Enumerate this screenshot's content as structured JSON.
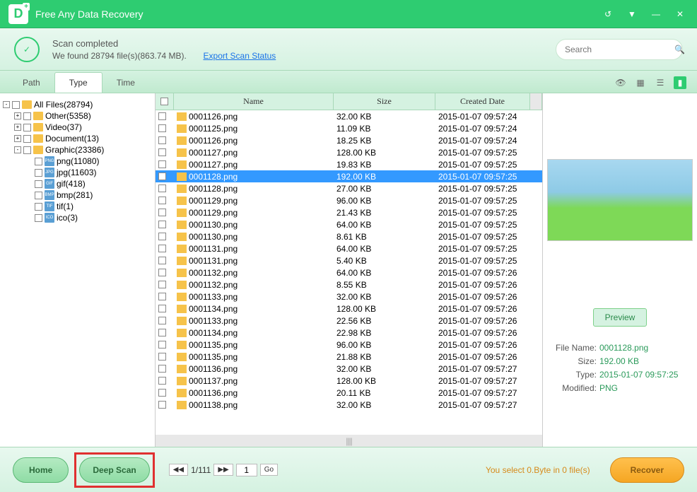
{
  "titlebar": {
    "app_name": "Free Any Data Recovery"
  },
  "status": {
    "title": "Scan completed",
    "detail": "We found 28794 file(s)(863.74 MB).",
    "export_link": "Export Scan Status"
  },
  "search": {
    "placeholder": "Search"
  },
  "tabs": {
    "path": "Path",
    "type": "Type",
    "time": "Time"
  },
  "tree": [
    {
      "level": 0,
      "toggle": "-",
      "label": "All Files(28794)",
      "icon": "folder"
    },
    {
      "level": 1,
      "toggle": "+",
      "label": "Other(5358)",
      "icon": "folder"
    },
    {
      "level": 1,
      "toggle": "+",
      "label": "Video(37)",
      "icon": "folder"
    },
    {
      "level": 1,
      "toggle": "+",
      "label": "Document(13)",
      "icon": "folder"
    },
    {
      "level": 1,
      "toggle": "-",
      "label": "Graphic(23386)",
      "icon": "folder"
    },
    {
      "level": 2,
      "toggle": "",
      "label": "png(11080)",
      "icon": "png"
    },
    {
      "level": 2,
      "toggle": "",
      "label": "jpg(11603)",
      "icon": "jpg"
    },
    {
      "level": 2,
      "toggle": "",
      "label": "gif(418)",
      "icon": "gif"
    },
    {
      "level": 2,
      "toggle": "",
      "label": "bmp(281)",
      "icon": "bmp"
    },
    {
      "level": 2,
      "toggle": "",
      "label": "tif(1)",
      "icon": "tif"
    },
    {
      "level": 2,
      "toggle": "",
      "label": "ico(3)",
      "icon": "ico"
    }
  ],
  "columns": {
    "name": "Name",
    "size": "Size",
    "date": "Created Date"
  },
  "files": [
    {
      "name": "0001126.png",
      "size": "32.00 KB",
      "date": "2015-01-07 09:57:24"
    },
    {
      "name": "0001125.png",
      "size": "11.09 KB",
      "date": "2015-01-07 09:57:24"
    },
    {
      "name": "0001126.png",
      "size": "18.25 KB",
      "date": "2015-01-07 09:57:24"
    },
    {
      "name": "0001127.png",
      "size": "128.00 KB",
      "date": "2015-01-07 09:57:25"
    },
    {
      "name": "0001127.png",
      "size": "19.83 KB",
      "date": "2015-01-07 09:57:25"
    },
    {
      "name": "0001128.png",
      "size": "192.00 KB",
      "date": "2015-01-07 09:57:25",
      "selected": true
    },
    {
      "name": "0001128.png",
      "size": "27.00 KB",
      "date": "2015-01-07 09:57:25"
    },
    {
      "name": "0001129.png",
      "size": "96.00 KB",
      "date": "2015-01-07 09:57:25"
    },
    {
      "name": "0001129.png",
      "size": "21.43 KB",
      "date": "2015-01-07 09:57:25"
    },
    {
      "name": "0001130.png",
      "size": "64.00 KB",
      "date": "2015-01-07 09:57:25"
    },
    {
      "name": "0001130.png",
      "size": "8.61 KB",
      "date": "2015-01-07 09:57:25"
    },
    {
      "name": "0001131.png",
      "size": "64.00 KB",
      "date": "2015-01-07 09:57:25"
    },
    {
      "name": "0001131.png",
      "size": "5.40 KB",
      "date": "2015-01-07 09:57:25"
    },
    {
      "name": "0001132.png",
      "size": "64.00 KB",
      "date": "2015-01-07 09:57:26"
    },
    {
      "name": "0001132.png",
      "size": "8.55 KB",
      "date": "2015-01-07 09:57:26"
    },
    {
      "name": "0001133.png",
      "size": "32.00 KB",
      "date": "2015-01-07 09:57:26"
    },
    {
      "name": "0001134.png",
      "size": "128.00 KB",
      "date": "2015-01-07 09:57:26"
    },
    {
      "name": "0001133.png",
      "size": "22.56 KB",
      "date": "2015-01-07 09:57:26"
    },
    {
      "name": "0001134.png",
      "size": "22.98 KB",
      "date": "2015-01-07 09:57:26"
    },
    {
      "name": "0001135.png",
      "size": "96.00 KB",
      "date": "2015-01-07 09:57:26"
    },
    {
      "name": "0001135.png",
      "size": "21.88 KB",
      "date": "2015-01-07 09:57:26"
    },
    {
      "name": "0001136.png",
      "size": "32.00 KB",
      "date": "2015-01-07 09:57:27"
    },
    {
      "name": "0001137.png",
      "size": "128.00 KB",
      "date": "2015-01-07 09:57:27"
    },
    {
      "name": "0001136.png",
      "size": "20.11 KB",
      "date": "2015-01-07 09:57:27"
    },
    {
      "name": "0001138.png",
      "size": "32.00 KB",
      "date": "2015-01-07 09:57:27"
    }
  ],
  "preview": {
    "button": "Preview",
    "props": {
      "filename_label": "File Name:",
      "filename": "0001128.png",
      "size_label": "Size:",
      "size": "192.00 KB",
      "type_label": "Type:",
      "type": "2015-01-07 09:57:25",
      "modified_label": "Modified:",
      "modified": "PNG"
    }
  },
  "footer": {
    "home": "Home",
    "deepscan": "Deep Scan",
    "pager_text": "1/111",
    "pager_input": "1",
    "go": "Go",
    "select_info": "You select 0.Byte in 0 file(s)",
    "recover": "Recover"
  }
}
